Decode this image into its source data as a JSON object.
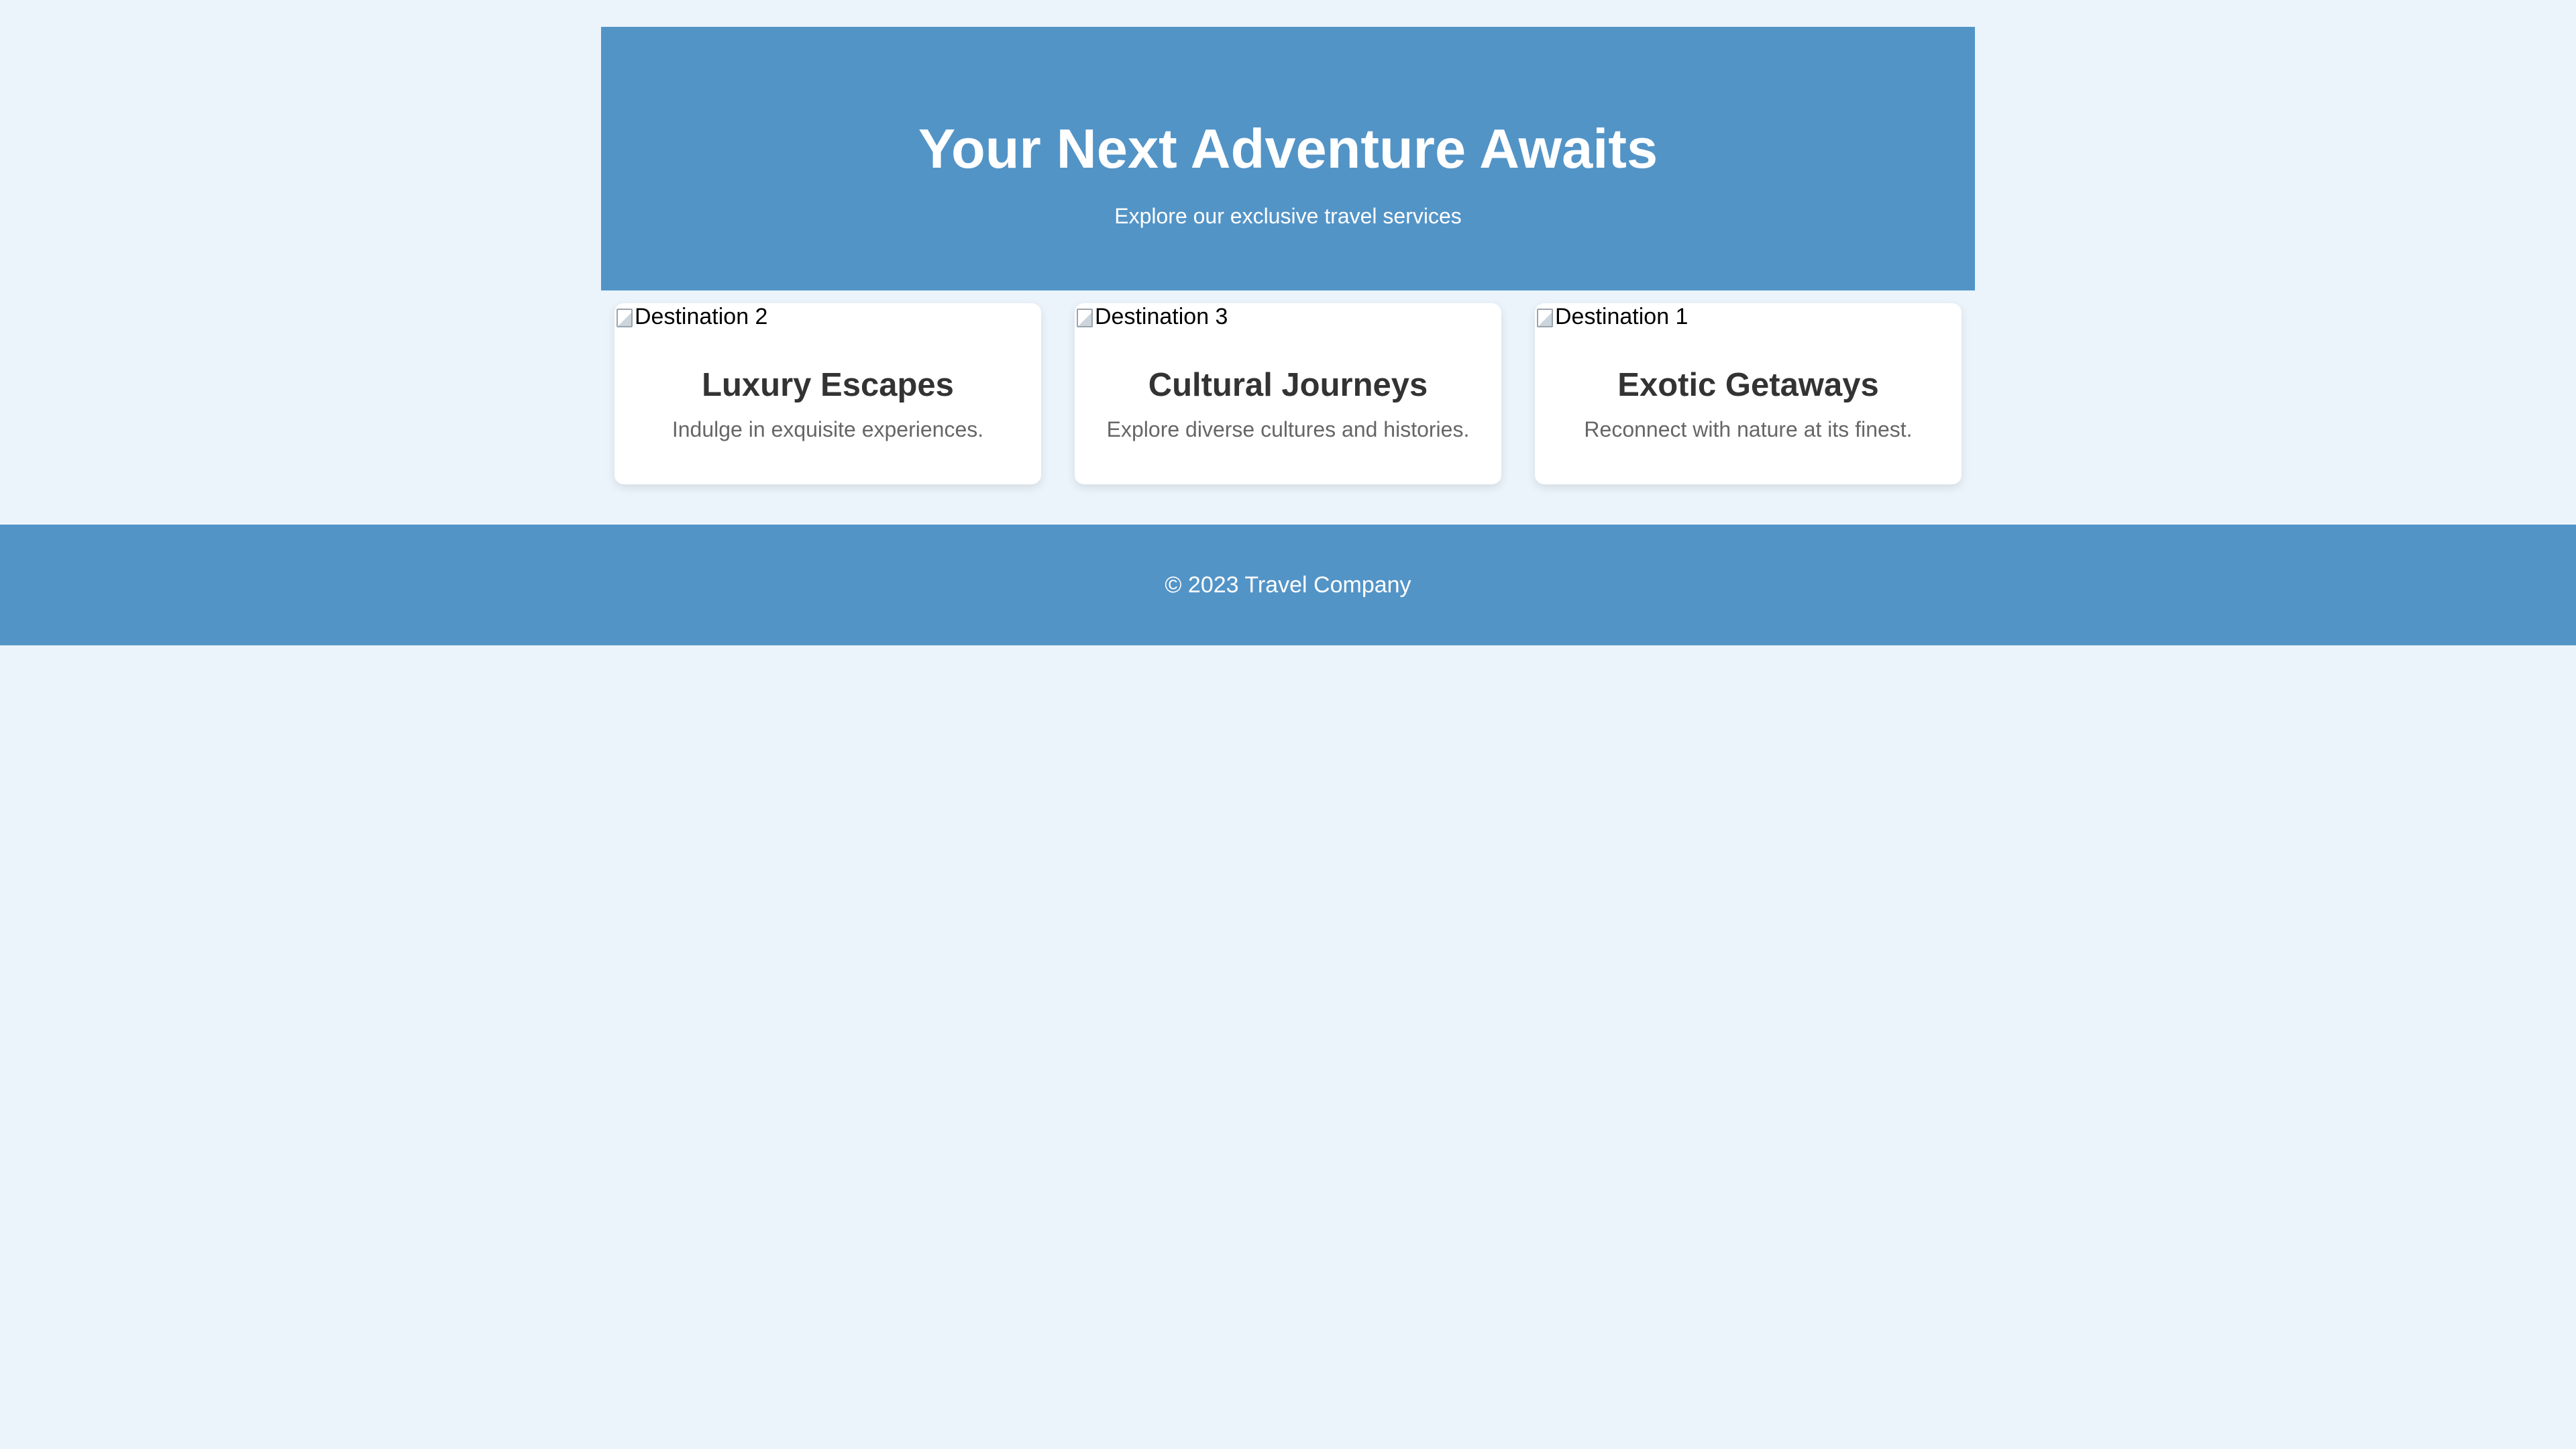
{
  "hero": {
    "title": "Your Next Adventure Awaits",
    "subtitle": "Explore our exclusive travel services"
  },
  "cards": [
    {
      "image_alt": "Destination 2",
      "title": "Luxury Escapes",
      "description": "Indulge in exquisite experiences."
    },
    {
      "image_alt": "Destination 3",
      "title": "Cultural Journeys",
      "description": "Explore diverse cultures and histories."
    },
    {
      "image_alt": "Destination 1",
      "title": "Exotic Getaways",
      "description": "Reconnect with nature at its finest."
    }
  ],
  "footer": {
    "copyright": "© 2023 Travel Company"
  },
  "colors": {
    "page_background": "#ebf4fb",
    "accent": "#5394c7",
    "card_background": "#ffffff",
    "heading_text": "#333333",
    "body_text": "#666666"
  },
  "icons": {
    "card_image": "broken-image-icon"
  }
}
